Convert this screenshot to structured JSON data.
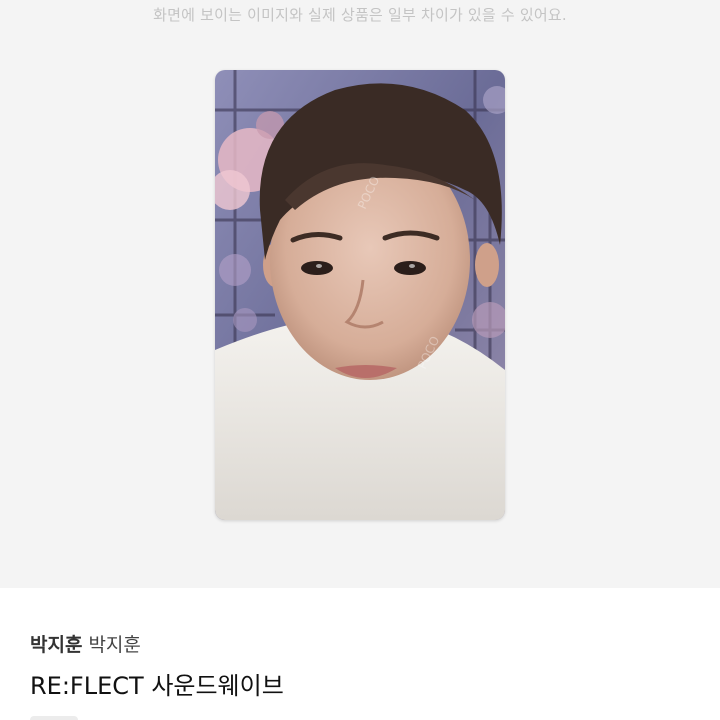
{
  "notice": {
    "disclaimer": "화면에 보이는 이미지와 실제 상품은 일부 차이가 있을 수 있어요."
  },
  "product_image": {
    "watermark": "POCO 포카마켓"
  },
  "product_info": {
    "artist_primary": "박지훈",
    "artist_secondary": "박지훈",
    "title": "RE:FLECT 사운드웨이브"
  },
  "colors": {
    "preview_bg": "#f4f4f4",
    "disclaimer_text": "#c4c4c4",
    "title_text": "#111111"
  }
}
